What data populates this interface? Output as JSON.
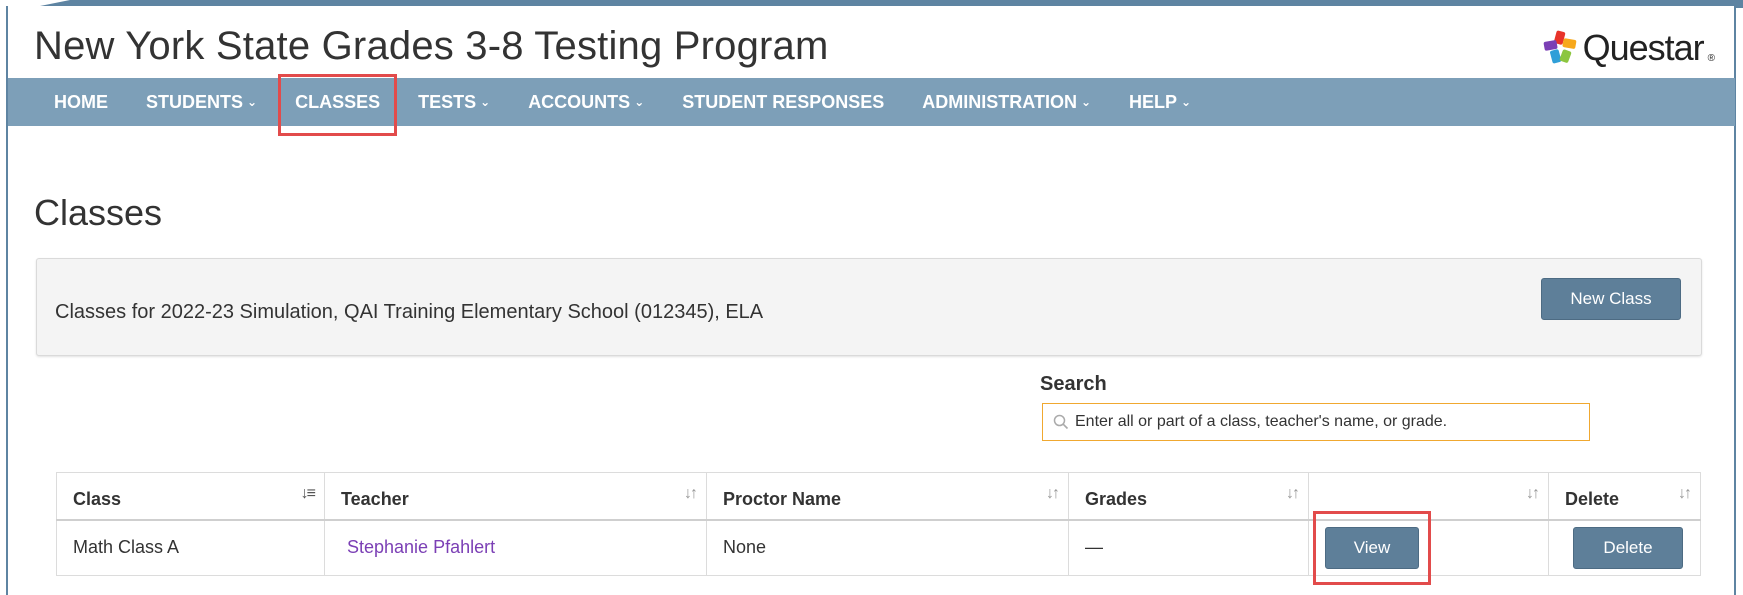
{
  "app": {
    "title": "New York State Grades 3-8 Testing Program",
    "logo_text": "Questar",
    "logo_reg": "®"
  },
  "nav": {
    "items": [
      {
        "label": "HOME",
        "caret": false
      },
      {
        "label": "STUDENTS",
        "caret": true
      },
      {
        "label": "CLASSES",
        "caret": false
      },
      {
        "label": "TESTS",
        "caret": true
      },
      {
        "label": "ACCOUNTS",
        "caret": true
      },
      {
        "label": "STUDENT RESPONSES",
        "caret": false
      },
      {
        "label": "ADMINISTRATION",
        "caret": true
      },
      {
        "label": "HELP",
        "caret": true
      }
    ],
    "caret_glyph": "⌄"
  },
  "page": {
    "title": "Classes",
    "panel_text": "Classes for 2022-23 Simulation, QAI Training Elementary School (012345), ELA",
    "new_class_label": "New Class"
  },
  "search": {
    "label": "Search",
    "placeholder": "Enter all or part of a class, teacher's name, or grade.",
    "value": ""
  },
  "table": {
    "headers": [
      "Class",
      "Teacher",
      "Proctor Name",
      "Grades",
      "",
      "Delete"
    ],
    "rows": [
      {
        "class": "Math Class A",
        "teacher": "Stephanie Pfahlert",
        "proctor": "None",
        "grades": "—",
        "view_label": "View",
        "delete_label": "Delete"
      }
    ]
  },
  "colors": {
    "navbar": "#7d9fb8",
    "button": "#5e7f99",
    "highlight": "#e24b4b",
    "search_border": "#f0a830",
    "link": "#7b3fb5"
  }
}
